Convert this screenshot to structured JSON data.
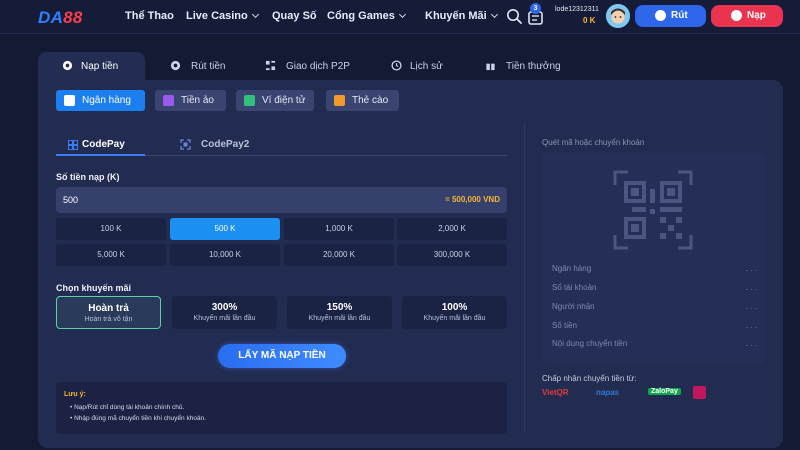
{
  "brand": {
    "part1": "DA",
    "part2": "88"
  },
  "nav": [
    {
      "label": "Thể Thao"
    },
    {
      "label": "Live Casino"
    },
    {
      "label": "Quay Số"
    },
    {
      "label": "Cổng Games"
    },
    {
      "label": "Khuyến Mãi"
    }
  ],
  "header": {
    "notification_count": "3",
    "username": "lode12312311",
    "balance": "0 K",
    "withdraw_label": "Rút",
    "deposit_label": "Nạp"
  },
  "tabs": [
    {
      "label": "Nạp tiền"
    },
    {
      "label": "Rút tiền"
    },
    {
      "label": "Giao dịch P2P"
    },
    {
      "label": "Lịch sử"
    },
    {
      "label": "Tiền thưởng"
    }
  ],
  "methods": [
    {
      "label": "Ngân hàng"
    },
    {
      "label": "Tiền ảo"
    },
    {
      "label": "Ví điện tử"
    },
    {
      "label": "Thẻ cào"
    }
  ],
  "subtabs": [
    {
      "label": "CodePay"
    },
    {
      "label": "CodePay2"
    }
  ],
  "amount": {
    "label": "Số tiền nạp (K)",
    "value": "500",
    "converted": "= 500,000 VND"
  },
  "quick_amounts": [
    "100 K",
    "500 K",
    "1,000 K",
    "2,000 K",
    "5,000 K",
    "10,000 K",
    "20,000 K",
    "300,000 K"
  ],
  "promo": {
    "label": "Chọn khuyến mãi",
    "options": [
      {
        "title": "Hoàn trả",
        "subtitle": "Hoàn trả vô tận"
      },
      {
        "title": "300%",
        "subtitle": "Khuyến mãi lần đầu"
      },
      {
        "title": "150%",
        "subtitle": "Khuyến mãi lần đầu"
      },
      {
        "title": "100%",
        "subtitle": "Khuyến mãi lần đầu"
      }
    ]
  },
  "cta_label": "LẤY MÃ NẠP TIỀN",
  "note": {
    "title": "Lưu ý:",
    "lines": [
      "• Nạp/Rút chỉ dùng tài khoản chính chủ.",
      "• Nhập đúng mã chuyển tiền khi chuyển khoản."
    ]
  },
  "qr": {
    "title": "Quét mã hoặc chuyển khoản",
    "rows": [
      {
        "label": "Ngân hàng",
        "value": ". . ."
      },
      {
        "label": "Số tài khoản",
        "value": ". . ."
      },
      {
        "label": "Người nhận",
        "value": ". . ."
      },
      {
        "label": "Số tiền",
        "value": ". . ."
      },
      {
        "label": "Nội dung chuyển tiền",
        "value": ". . ."
      }
    ]
  },
  "accept": {
    "label": "Chấp nhận chuyển tiền từ:",
    "providers": [
      {
        "name": "VietQR"
      },
      {
        "name": "napas"
      },
      {
        "name": "ZaloPay"
      },
      {
        "name": "MoMo"
      }
    ]
  },
  "colors": {
    "background": "#131a33",
    "panel": "#222b50",
    "accent_blue": "#1c8ff3",
    "deposit_red": "#e9334f",
    "gold": "#f5b530"
  }
}
